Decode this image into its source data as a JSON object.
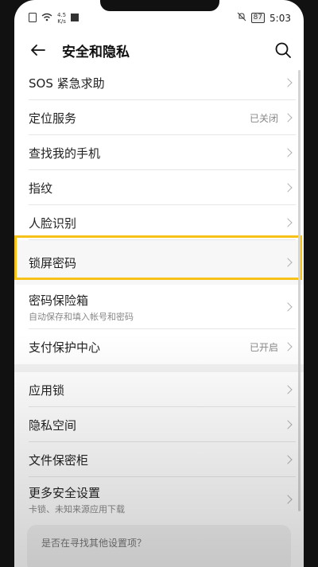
{
  "status": {
    "speed_top": "4.5",
    "speed_unit": "K/s",
    "battery": "87",
    "time": "5:03"
  },
  "header": {
    "title": "安全和隐私"
  },
  "items": [
    {
      "label": "SOS 紧急求助",
      "value": ""
    },
    {
      "label": "定位服务",
      "value": "已关闭"
    },
    {
      "label": "查找我的手机",
      "value": ""
    },
    {
      "label": "指纹",
      "value": ""
    },
    {
      "label": "人脸识别",
      "value": ""
    },
    {
      "label": "锁屏密码",
      "value": ""
    },
    {
      "label": "密码保险箱",
      "sub": "自动保存和填入帐号和密码",
      "value": ""
    },
    {
      "label": "支付保护中心",
      "value": "已开启"
    },
    {
      "label": "应用锁",
      "value": ""
    },
    {
      "label": "隐私空间",
      "value": ""
    },
    {
      "label": "文件保密柜",
      "value": ""
    },
    {
      "label": "更多安全设置",
      "sub": "卡锁、未知来源应用下载",
      "value": ""
    }
  ],
  "bottom": {
    "question": "是否在寻找其他设置项？"
  },
  "colors": {
    "highlight": "#f6c21a"
  }
}
